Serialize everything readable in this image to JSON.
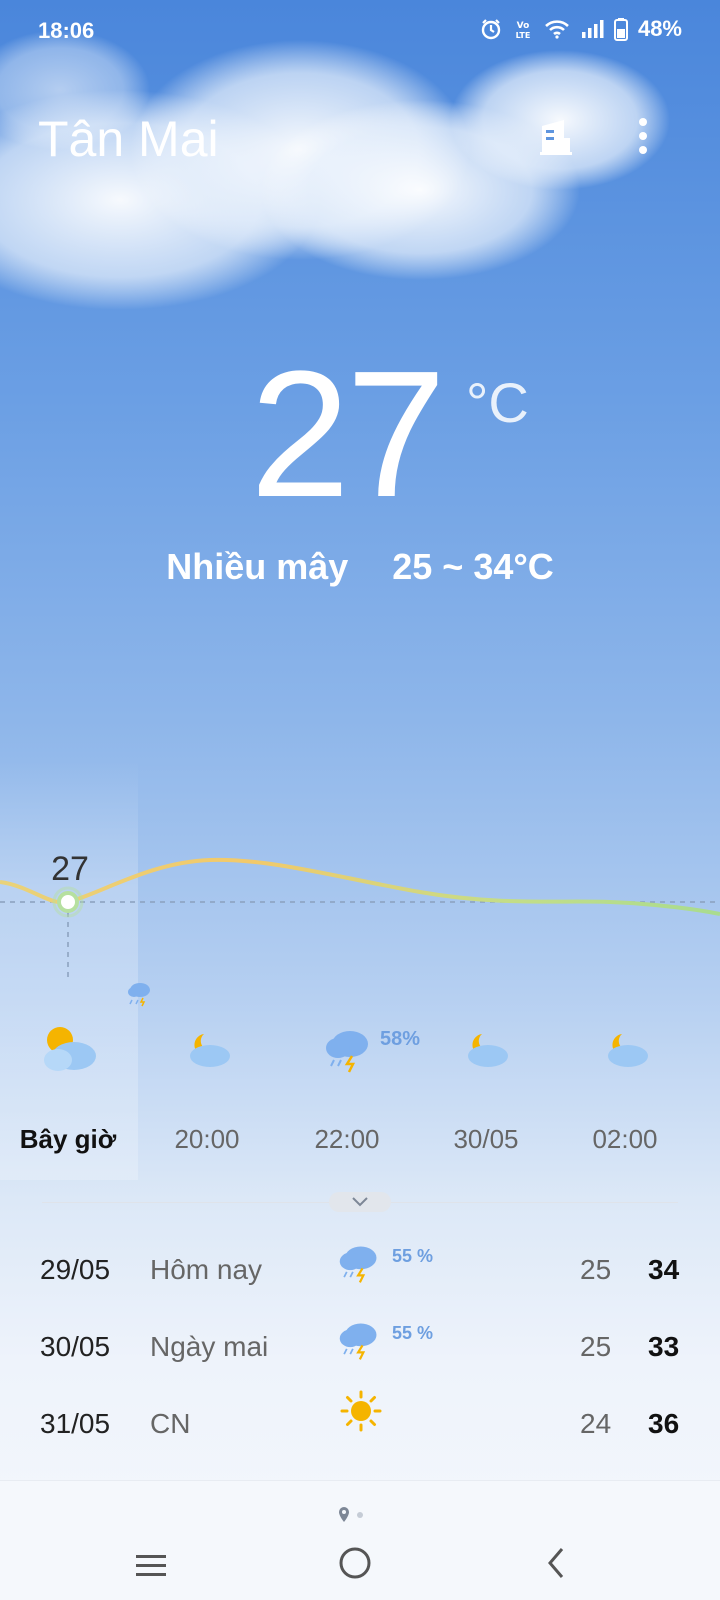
{
  "status_bar": {
    "time": "18:06",
    "battery": "48%",
    "icons": [
      "alarm-icon",
      "volte-icon",
      "wifi-icon",
      "signal-icon",
      "battery-icon"
    ]
  },
  "header": {
    "city": "Tân Mai",
    "building_icon": "building-icon",
    "more_icon": "more-vert-icon"
  },
  "current": {
    "temperature": "27",
    "unit": "°C",
    "condition": "Nhiều mây",
    "range": "25 ~ 34°C"
  },
  "hourly": {
    "current_temp_label": "27",
    "items": [
      {
        "label": "Bây giờ",
        "icon": "partly-cloudy-day-icon",
        "precip": ""
      },
      {
        "label": "20:00",
        "icon": "cloudy-night-icon",
        "precip": ""
      },
      {
        "label": "22:00",
        "icon": "thunderstorm-icon",
        "precip": "58%"
      },
      {
        "label": "30/05",
        "icon": "cloudy-night-icon",
        "precip": ""
      },
      {
        "label": "02:00",
        "icon": "cloudy-night-icon",
        "precip": ""
      }
    ]
  },
  "daily": [
    {
      "date": "29/05",
      "name": "Hôm nay",
      "icon": "thunderstorm-icon",
      "precip": "55 %",
      "low": "25",
      "high": "34"
    },
    {
      "date": "30/05",
      "name": "Ngày mai",
      "icon": "thunderstorm-icon",
      "precip": "55 %",
      "low": "25",
      "high": "33"
    },
    {
      "date": "31/05",
      "name": "CN",
      "icon": "sunny-icon",
      "precip": "",
      "low": "24",
      "high": "36"
    }
  ],
  "colors": {
    "accent_precip": "#6e9fe0",
    "sun": "#f5b400",
    "chart_warm": "#f2c96a",
    "chart_cool": "#a9dc8f"
  }
}
